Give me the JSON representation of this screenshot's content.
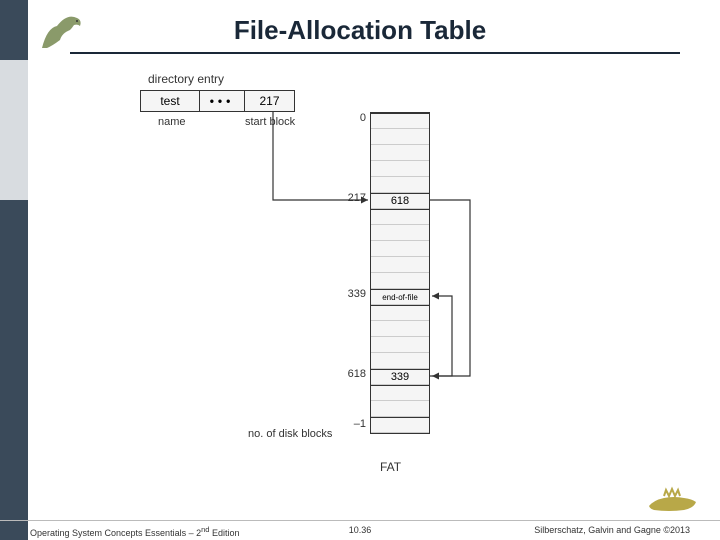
{
  "title": "File-Allocation Table",
  "dir_entry_label": "directory entry",
  "dir_row": {
    "name": "test",
    "dots": "•••",
    "start": "217"
  },
  "dir_under": {
    "name_label": "name",
    "start_label": "start block"
  },
  "fat": {
    "index_0": "0",
    "index_217": "217",
    "value_217": "618",
    "index_339": "339",
    "value_339": "end-of-file",
    "index_618": "618",
    "value_618": "339",
    "minus1": "–1"
  },
  "disk_blocks_label": "no. of disk blocks",
  "fat_caption": "FAT",
  "footer": {
    "left_a": "Operating System Concepts Essentials – 2",
    "left_sup": "nd",
    "left_b": " Edition",
    "center": "10.36",
    "right": "Silberschatz, Galvin and Gagne ©2013"
  }
}
